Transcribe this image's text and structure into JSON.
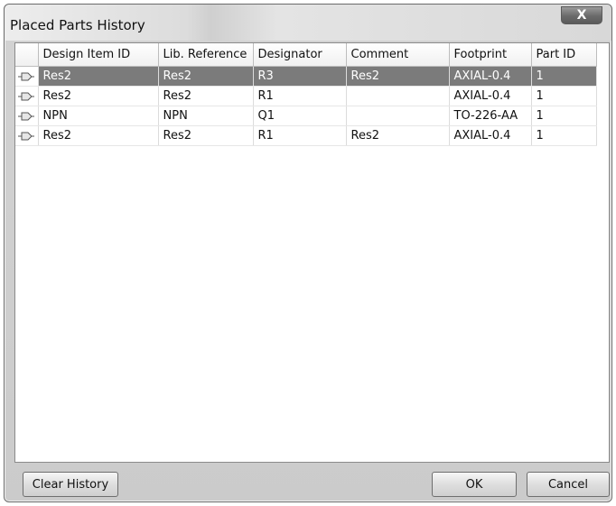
{
  "window": {
    "title": "Placed Parts History",
    "close_symbol": "X"
  },
  "table": {
    "columns": [
      "Design Item ID",
      "Lib. Reference",
      "Designator",
      "Comment",
      "Footprint",
      "Part ID"
    ],
    "row_icon": "component-plug-icon",
    "selected_row": 0,
    "rows": [
      [
        "Res2",
        "Res2",
        "R3",
        "Res2",
        "AXIAL-0.4",
        "1"
      ],
      [
        "Res2",
        "Res2",
        "R1",
        "",
        "AXIAL-0.4",
        "1"
      ],
      [
        "NPN",
        "NPN",
        "Q1",
        "",
        "TO-226-AA",
        "1"
      ],
      [
        "Res2",
        "Res2",
        "R1",
        "Res2",
        "AXIAL-0.4",
        "1"
      ]
    ]
  },
  "buttons": {
    "clear_history": "Clear History",
    "ok": "OK",
    "cancel": "Cancel"
  },
  "colors": {
    "selected_row_bg": "#7b7b7b",
    "selected_row_text": "#ffffff"
  }
}
